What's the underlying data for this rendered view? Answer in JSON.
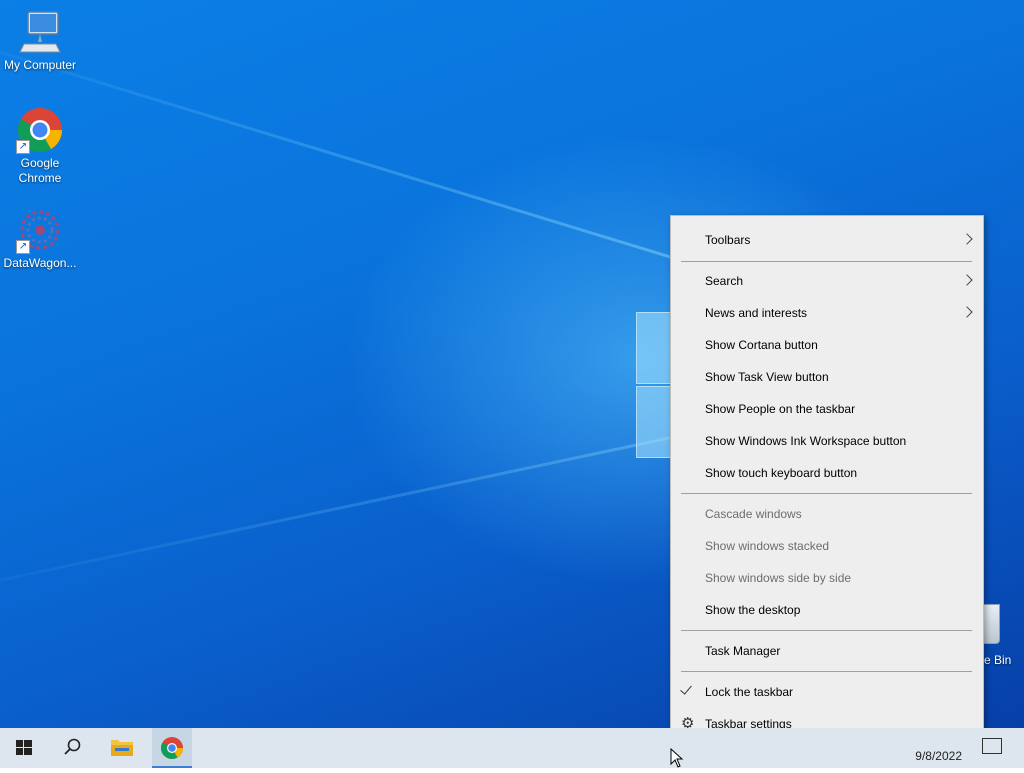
{
  "desktop": {
    "icons": [
      {
        "label": "My Computer",
        "icon": "computer-icon"
      },
      {
        "label": "Google Chrome",
        "icon": "chrome-icon"
      },
      {
        "label": "DataWagon...",
        "icon": "datawagon-icon"
      }
    ],
    "recycle_bin_label": "e Bin"
  },
  "context_menu": {
    "toolbars": "Toolbars",
    "search": "Search",
    "news": "News and interests",
    "cortana": "Show Cortana button",
    "task_view": "Show Task View button",
    "people": "Show People on the taskbar",
    "ink": "Show Windows Ink Workspace button",
    "touch_kb": "Show touch keyboard button",
    "cascade": "Cascade windows",
    "stacked": "Show windows stacked",
    "side_by_side": "Show windows side by side",
    "show_desktop": "Show the desktop",
    "task_manager": "Task Manager",
    "lock_taskbar": "Lock the taskbar",
    "lock_taskbar_checked": true,
    "taskbar_settings": "Taskbar settings"
  },
  "taskbar": {
    "start_icon": "windows-start-icon",
    "search_icon": "search-icon",
    "explorer_icon": "folder-icon",
    "chrome_icon": "chrome-icon",
    "date": "9/8/2022"
  },
  "colors": {
    "accent": "#3a7fd1",
    "desktop": "#0a74dc",
    "menu_bg": "#eeeeee",
    "taskbar_bg": "#dde6ef"
  }
}
